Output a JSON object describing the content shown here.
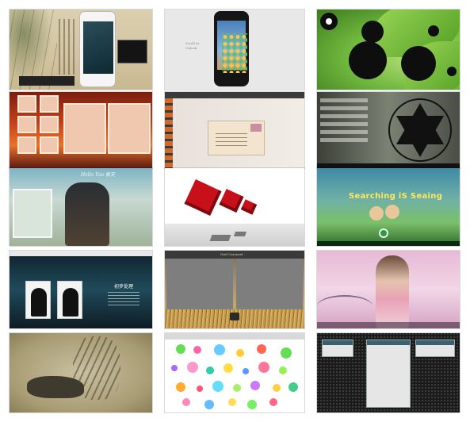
{
  "tiles": [
    {
      "id": "tile-1"
    },
    {
      "id": "tile-2",
      "lines": [
        "Scroll to",
        "Unlock"
      ]
    },
    {
      "id": "tile-3"
    },
    {
      "id": "tile-4"
    },
    {
      "id": "tile-5"
    },
    {
      "id": "tile-6"
    },
    {
      "id": "tile-7",
      "title": "Hello You 紫天"
    },
    {
      "id": "tile-8"
    },
    {
      "id": "tile-9",
      "title": "Searching iS Seaing"
    },
    {
      "id": "tile-10",
      "title": "初步处理"
    },
    {
      "id": "tile-11",
      "title": "Grid Carousel"
    },
    {
      "id": "tile-12"
    },
    {
      "id": "tile-13"
    },
    {
      "id": "tile-14"
    },
    {
      "id": "tile-15"
    }
  ]
}
